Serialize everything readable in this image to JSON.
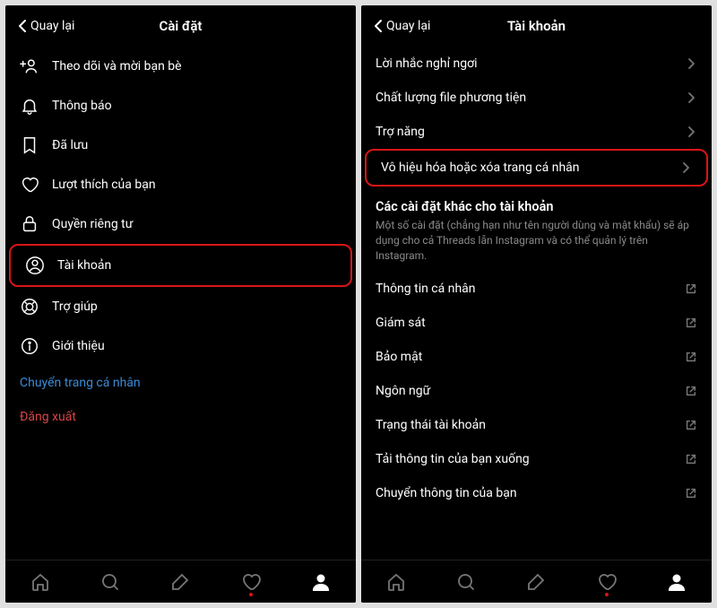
{
  "left": {
    "back_label": "Quay lại",
    "title": "Cài đặt",
    "items": [
      {
        "icon": "add-user",
        "label": "Theo dõi và mời bạn bè"
      },
      {
        "icon": "bell",
        "label": "Thông báo"
      },
      {
        "icon": "bookmark",
        "label": "Đã lưu"
      },
      {
        "icon": "heart",
        "label": "Lượt thích của bạn"
      },
      {
        "icon": "lock",
        "label": "Quyền riêng tư"
      },
      {
        "icon": "user-circle",
        "label": "Tài khoản",
        "highlight": true
      },
      {
        "icon": "lifebuoy",
        "label": "Trợ giúp"
      },
      {
        "icon": "info",
        "label": "Giới thiệu"
      }
    ],
    "link_switch": "Chuyển trang cá nhân",
    "link_logout": "Đăng xuất"
  },
  "right": {
    "back_label": "Quay lại",
    "title": "Tài khoản",
    "items_top": [
      {
        "label": "Lời nhắc nghỉ ngơi"
      },
      {
        "label": "Chất lượng file phương tiện"
      },
      {
        "label": "Trợ năng"
      },
      {
        "label": "Vô hiệu hóa hoặc xóa trang cá nhân",
        "highlight": true
      }
    ],
    "section_title": "Các cài đặt khác cho tài khoản",
    "section_desc": "Một số cài đặt (chẳng hạn như tên người dùng và mật khẩu) sẽ áp dụng cho cả Threads lẫn Instagram và có thể quản lý trên Instagram.",
    "items_ext": [
      {
        "label": "Thông tin cá nhân"
      },
      {
        "label": "Giám sát"
      },
      {
        "label": "Bảo mật"
      },
      {
        "label": "Ngôn ngữ"
      },
      {
        "label": "Trạng thái tài khoản"
      },
      {
        "label": "Tải thông tin của bạn xuống"
      },
      {
        "label": "Chuyển thông tin của bạn"
      }
    ]
  }
}
